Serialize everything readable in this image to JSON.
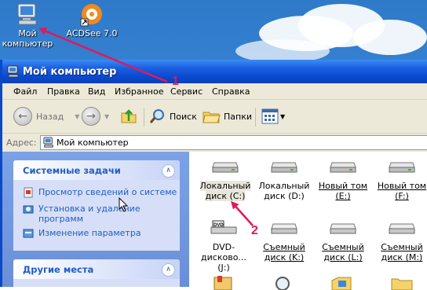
{
  "desktop": {
    "icons": [
      {
        "label_line1": "Мой",
        "label_line2": "компьютер"
      },
      {
        "label_line1": "ACDSee 7.0",
        "label_line2": ""
      }
    ]
  },
  "window": {
    "title": "Мой компьютер",
    "menu": [
      "Файл",
      "Правка",
      "Вид",
      "Избранное",
      "Сервис",
      "Справка"
    ],
    "toolbar": {
      "back": "Назад",
      "search": "Поиск",
      "folders": "Папки"
    },
    "address": {
      "label": "Адрес:",
      "value": "Мой компьютер"
    }
  },
  "left_pane": {
    "system_tasks": {
      "title": "Системные задачи",
      "items": [
        {
          "line1": "Просмотр сведений о системе",
          "line2": ""
        },
        {
          "line1": "Установка и удаление",
          "line2": "программ"
        },
        {
          "line1": "Изменение параметра",
          "line2": ""
        }
      ]
    },
    "other_places": {
      "title": "Другие места"
    }
  },
  "drives": [
    {
      "line1": "Локальный",
      "line2": "диск (C:)",
      "icon": "hard-drive-icon"
    },
    {
      "line1": "Локальный",
      "line2": "диск (D:)",
      "icon": "hard-drive-icon"
    },
    {
      "line1": "Новый том",
      "line2": "(E:)",
      "icon": "hard-drive-icon"
    },
    {
      "line1": "Новый том",
      "line2": "(F:)",
      "icon": "hard-drive-icon"
    },
    {
      "line1": "DVD-дисково...",
      "line2": "(J:)",
      "icon": "dvd-drive-icon"
    },
    {
      "line1": "Съемный",
      "line2": "диск (K:)",
      "icon": "removable-drive-icon"
    },
    {
      "line1": "Съемный",
      "line2": "диск (L:)",
      "icon": "removable-drive-icon"
    },
    {
      "line1": "Съемный",
      "line2": "диск (M:)",
      "icon": "removable-drive-icon"
    }
  ],
  "annotations": {
    "step1": "1",
    "step2": "2",
    "arrow_color": "#e0195c"
  },
  "colors": {
    "xp_title_blue": "#0b4bd0",
    "task_link": "#215dc6"
  }
}
